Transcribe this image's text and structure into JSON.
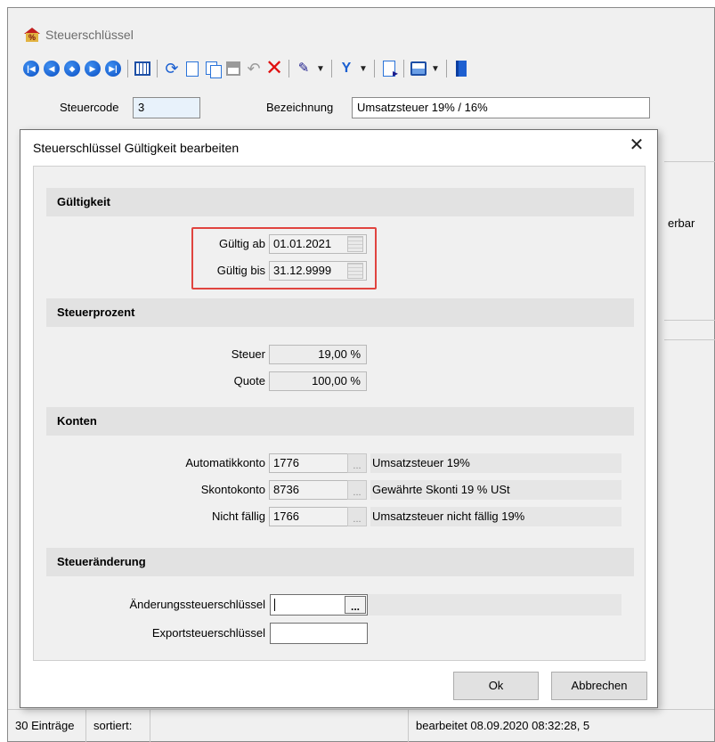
{
  "main_window": {
    "title": "Steuerschlüssel",
    "icons": [
      "first-icon",
      "previous-icon",
      "page-previous-icon",
      "next-icon",
      "last-icon",
      "calendar-icon",
      "refresh-icon",
      "new-icon",
      "copy-icon",
      "save-icon",
      "undo-icon",
      "delete-icon",
      "pin-icon",
      "filter-icon",
      "cursor-icon",
      "print-icon",
      "book-icon"
    ],
    "steuercode_label": "Steuercode",
    "steuercode_value": "3",
    "bezeichnung_label": "Bezeichnung",
    "bezeichnung_value": "Umsatzsteuer 19% / 16%",
    "side_text": "erbar"
  },
  "status_bar": {
    "entries": "30 Einträge",
    "sorted": "sortiert:",
    "edited": "bearbeitet 08.09.2020 08:32:28,  5"
  },
  "dialog": {
    "title": "Steuerschlüssel Gültigkeit bearbeiten",
    "close_glyph": "✕",
    "sections": {
      "validity": {
        "heading": "Gültigkeit",
        "from_label": "Gültig ab",
        "from_value": "01.01.2021",
        "to_label": "Gültig bis",
        "to_value": "31.12.9999"
      },
      "tax_percent": {
        "heading": "Steuerprozent",
        "tax_label": "Steuer",
        "tax_value": "19,00 %",
        "quota_label": "Quote",
        "quota_value": "100,00 %"
      },
      "accounts": {
        "heading": "Konten",
        "rows": [
          {
            "label": "Automatikkonto",
            "number": "1776",
            "name": "Umsatzsteuer 19%"
          },
          {
            "label": "Skontokonto",
            "number": "8736",
            "name": "Gewährte Skonti 19 % USt"
          },
          {
            "label": "Nicht fällig",
            "number": "1766",
            "name": "Umsatzsteuer nicht fällig 19%"
          }
        ],
        "lookup_glyph": "..."
      },
      "tax_change": {
        "heading": "Steueränderung",
        "change_key_label": "Änderungssteuerschlüssel",
        "change_key_value": "",
        "export_key_label": "Exportsteuerschlüssel",
        "export_key_value": "",
        "lookup_glyph": "..."
      }
    },
    "ok_label": "Ok",
    "cancel_label": "Abbrechen"
  },
  "colors": {
    "highlight_frame": "#e0443f",
    "nav_blue": "#0a4fc4",
    "delete_red": "#e01010"
  }
}
